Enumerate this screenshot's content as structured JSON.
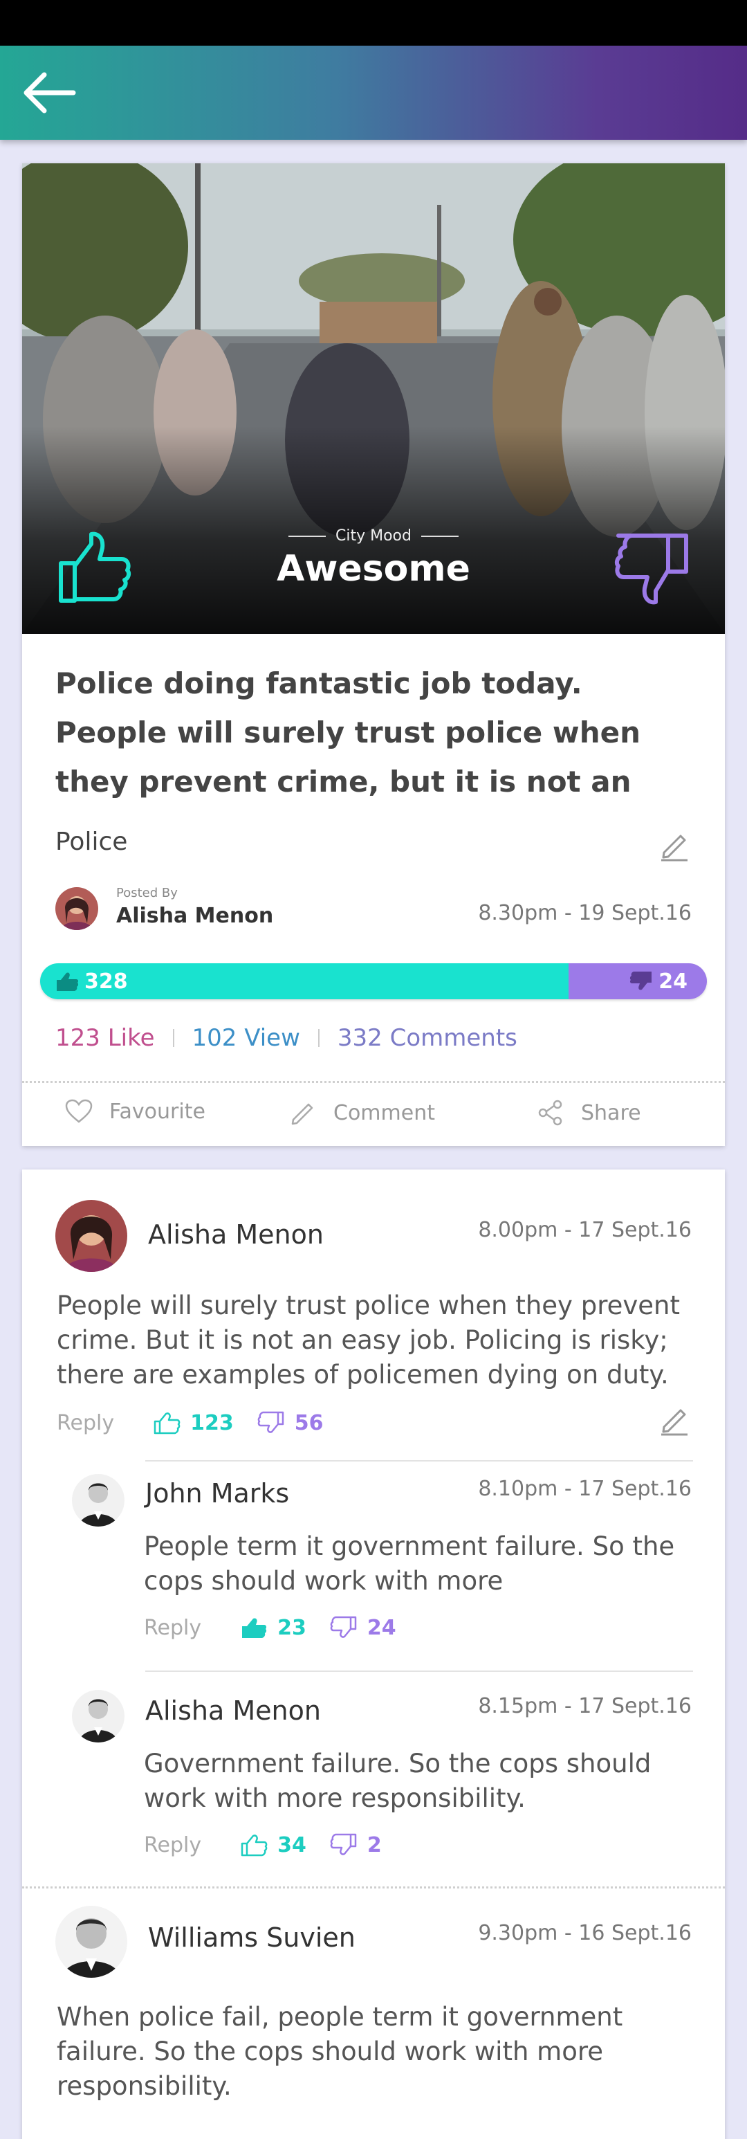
{
  "post": {
    "mood_caption": "City Mood",
    "mood_value": "Awesome",
    "title": "Police doing fantastic job today. People will surely trust police when they prevent crime, but it is not an easy jo...",
    "category": "Police",
    "posted_by_label": "Posted By",
    "author": "Alisha Menon",
    "time": "8.30pm - 19 Sept.16",
    "votes": {
      "likes": 328,
      "dislikes": 24,
      "likes_display": "328",
      "dislikes_display": "24"
    },
    "stats": {
      "likes_label": "123 Like",
      "views_label": "102 View",
      "comments_label": "332 Comments"
    },
    "actions": {
      "favourite": "Favourite",
      "comment": "Comment",
      "share": "Share"
    }
  },
  "comments": [
    {
      "name": "Alisha Menon",
      "time": "8.00pm - 17 Sept.16",
      "text": "People will surely trust police when they prevent crime. But it is not an easy job. Policing is risky; there are examples of policemen dying on duty.",
      "reply_label": "Reply",
      "likes": "123",
      "dislikes": "56",
      "replies": [
        {
          "name": "John Marks",
          "time": "8.10pm - 17 Sept.16",
          "text": "People term it government failure. So the cops should work with more",
          "reply_label": "Reply",
          "likes": "23",
          "dislikes": "24"
        },
        {
          "name": "Alisha Menon",
          "time": "8.15pm - 17 Sept.16",
          "text": "Government failure. So the cops should work with more responsibility.",
          "reply_label": "Reply",
          "likes": "34",
          "dislikes": "2"
        }
      ]
    },
    {
      "name": "Williams Suvien",
      "time": "9.30pm - 16 Sept.16",
      "text": "When police fail, people term it government failure. So the cops should work with more responsibility."
    }
  ],
  "colors": {
    "like": "#19e2cf",
    "dislike": "#9c7ae8",
    "stat_like": "#c04f8e",
    "stat_view": "#3c8fc7",
    "stat_comments": "#7b7bc6"
  }
}
